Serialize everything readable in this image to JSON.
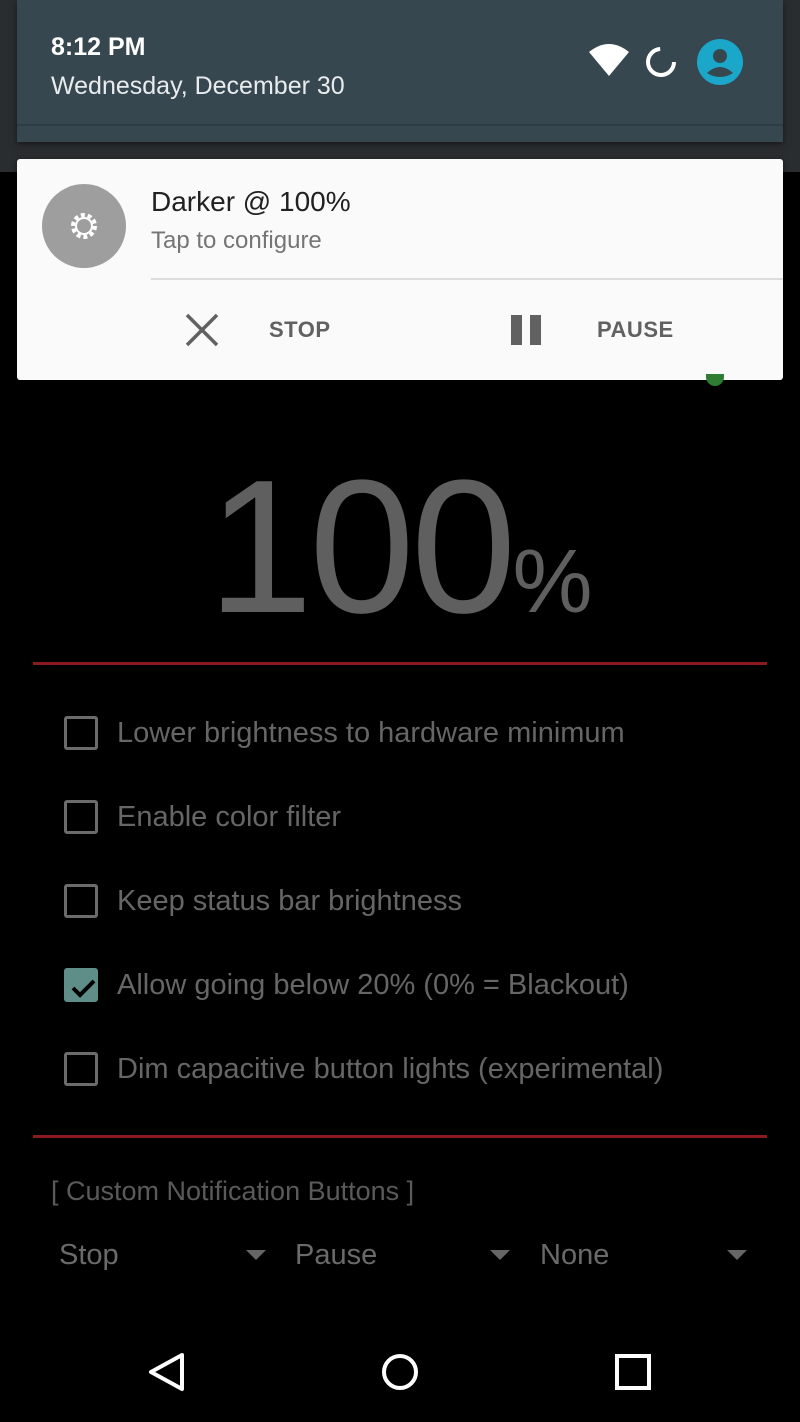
{
  "status": {
    "time": "8:12 PM",
    "date": "Wednesday, December 30"
  },
  "notification": {
    "title": "Darker @ 100%",
    "text": "Tap to configure",
    "actions": [
      {
        "label": "STOP",
        "icon": "close-icon"
      },
      {
        "label": "PAUSE",
        "icon": "pause-icon"
      }
    ]
  },
  "brightness": {
    "value": "100",
    "unit": "%"
  },
  "options": [
    {
      "label": "Lower brightness to hardware minimum",
      "checked": false
    },
    {
      "label": "Enable color filter",
      "checked": false
    },
    {
      "label": "Keep status bar brightness",
      "checked": false
    },
    {
      "label": "Allow going below 20% (0% = Blackout)",
      "checked": true
    },
    {
      "label": "Dim capacitive button lights (experimental)",
      "checked": false
    }
  ],
  "custom_buttons": {
    "heading": "[ Custom Notification Buttons ]",
    "dropdowns": [
      "Stop",
      "Pause",
      "None"
    ]
  },
  "colors": {
    "accent_red": "#8b1a1e",
    "checkbox_checked": "#5e8e87",
    "avatar": "#1aa7c9",
    "shade": "#37474f"
  },
  "navbar": [
    "back-icon",
    "home-icon",
    "recents-icon"
  ]
}
